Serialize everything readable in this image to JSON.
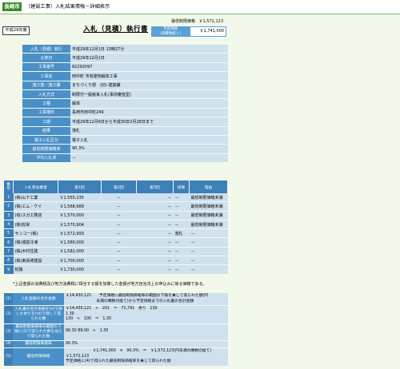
{
  "header": {
    "city": "長崎市",
    "title": "（建設工事）入札結果情報－詳細表示"
  },
  "year": "平成29年度",
  "doc_title": "入札（見積）執行書",
  "prices": {
    "min_limit_label": "最低制限価格",
    "min_limit_value": "￥1,572,123",
    "planned_label": "予定価格\n（消費税抜く）",
    "planned_value": "￥1,741,000"
  },
  "info": [
    {
      "label": "入札（見積）執行",
      "value": "平成29年12月1日 13時27分"
    },
    {
      "label": "公表日",
      "value": "平成29年12月1日"
    },
    {
      "label": "工事番号",
      "value": "82292097"
    },
    {
      "label": "工事名",
      "value": "田中町 市有建物解体工事"
    },
    {
      "label": "施工部／施工課",
      "value": "まちづくり部　(旧) 建築課"
    },
    {
      "label": "入札方式",
      "value": "制限付一般競争入札(事前審査型)"
    },
    {
      "label": "工種",
      "value": "解体"
    },
    {
      "label": "工事場所",
      "value": "長崎市田中町249"
    },
    {
      "label": "工期",
      "value": "平成29年12月6日から平成30年2月28日まで"
    },
    {
      "label": "結果",
      "value": "落札"
    },
    {
      "label": "電子入札区分",
      "value": "電子入札"
    },
    {
      "label": "最低制限価格率",
      "value": "90.3%"
    },
    {
      "label": "平均入札率",
      "value": "－"
    }
  ],
  "bids": {
    "headers": [
      "番号",
      "入札参加業者",
      "第1回",
      "第2回",
      "第3回",
      "結果",
      "理由"
    ],
    "rows": [
      {
        "no": "1",
        "name": "(株)山下工業",
        "r1": "￥1,555,235",
        "r2": "－",
        "r3": "－",
        "result": "－",
        "reason": "最低制限価格未満"
      },
      {
        "no": "2",
        "name": "(株)エム・ケイ",
        "r1": "￥1,568,989",
        "r2": "－",
        "r3": "－",
        "result": "－",
        "reason": "最低制限価格未満"
      },
      {
        "no": "3",
        "name": "(有)スガ工務店",
        "r1": "￥1,570,000",
        "r2": "－",
        "r3": "－",
        "result": "－",
        "reason": "最低制限価格未満"
      },
      {
        "no": "4",
        "name": "(株)松栄",
        "r1": "￥1,570,904",
        "r2": "－",
        "r3": "－",
        "result": "－",
        "reason": "最低制限価格未満"
      },
      {
        "no": "5",
        "name": "サンコー(株)",
        "r1": "￥1,572,993",
        "r2": "－",
        "r3": "－",
        "result": "落札",
        "reason": "－"
      },
      {
        "no": "6",
        "name": "(株)城前冷凍",
        "r1": "￥1,580,000",
        "r2": "－",
        "r3": "－",
        "result": "－",
        "reason": "－"
      },
      {
        "no": "7",
        "name": "(株)木村住建",
        "r1": "￥1,582,000",
        "r2": "－",
        "r3": "－",
        "result": "－",
        "reason": "－"
      },
      {
        "no": "8",
        "name": "(株)東長崎建設",
        "r1": "￥1,700,000",
        "r2": "－",
        "r3": "－",
        "result": "－",
        "reason": "－"
      },
      {
        "no": "9",
        "name": "松陽",
        "r1": "￥1,730,000",
        "r2": "－",
        "r3": "－",
        "result": "－",
        "reason": "－"
      }
    ]
  },
  "note": "*上記金額の消費税及び地方消費税に相当する額を加算した金額が地方自治法上の申込みに係る価格である。",
  "calc": [
    {
      "no": "(1)",
      "label": "入札金額の合計金額",
      "lines": [
        "￥14,430,121　　予定価格に最低制限価格率の範囲の下限を乗じて得られた額(円",
        "　　　　　　　　未満の端数切捨て)から予定価格までの入札書の合計金額"
      ]
    },
    {
      "no": "(2)",
      "label": "入札書の合計金額を(n)で除した余りを(m)で除して得られた数",
      "lines": [
        "￥14,430,121　÷　201　＝　71,791　余り　130",
        "1.30",
        "130　÷　100　＝　1.30"
      ]
    },
    {
      "no": "(3)",
      "label": "最低制限価格率の範囲の下限に(2)で得られた数を加えて得られた数",
      "lines": [
        "90.30 89.00　+　1.30"
      ]
    },
    {
      "no": "(4)",
      "label": "最低制限価格率",
      "lines": [
        "90.3%"
      ]
    },
    {
      "no": "(5)",
      "label": "最低制限価格",
      "lines": [
        "　　　　　　　￥1,741,000　×　90.3%　＝　￥1,572,123(円未満の端数切捨て)",
        "￥1,572,123",
        "予定価格に(4)で得られた最低制限価格率を乗じて得られた額"
      ]
    }
  ]
}
